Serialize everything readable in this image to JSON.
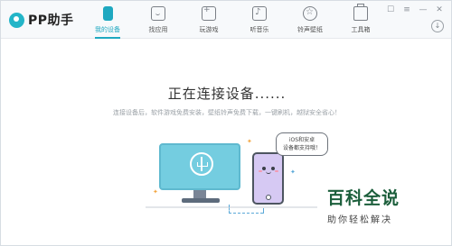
{
  "app": {
    "logo_text": "PP助手"
  },
  "nav": {
    "items": [
      {
        "label": "我的设备",
        "icon": "device-icon",
        "active": true
      },
      {
        "label": "找应用",
        "icon": "apps-icon",
        "active": false
      },
      {
        "label": "玩游戏",
        "icon": "games-icon",
        "active": false
      },
      {
        "label": "听音乐",
        "icon": "music-icon",
        "active": false
      },
      {
        "label": "铃声壁纸",
        "icon": "ringtone-wallpaper-icon",
        "active": false
      },
      {
        "label": "工具箱",
        "icon": "toolbox-icon",
        "active": false
      }
    ]
  },
  "window": {
    "skin": "☐",
    "menu": "≡",
    "minimize": "—",
    "close": "✕",
    "download": "↓"
  },
  "main": {
    "title": "正在连接设备......",
    "subtitle": "连接设备后，软件游戏免费安装，壁纸铃声免费下载，一键刷机，越狱安全省心！",
    "bubble_line1": "iOS和安卓",
    "bubble_line2": "设备都支持哦！"
  },
  "watermark": {
    "title": "百科全说",
    "subtitle": "助你轻松解决"
  },
  "colors": {
    "accent": "#1ea8c0",
    "monitor": "#74cde0",
    "phone": "#d6c9f3",
    "watermark": "#1b5e3b"
  }
}
